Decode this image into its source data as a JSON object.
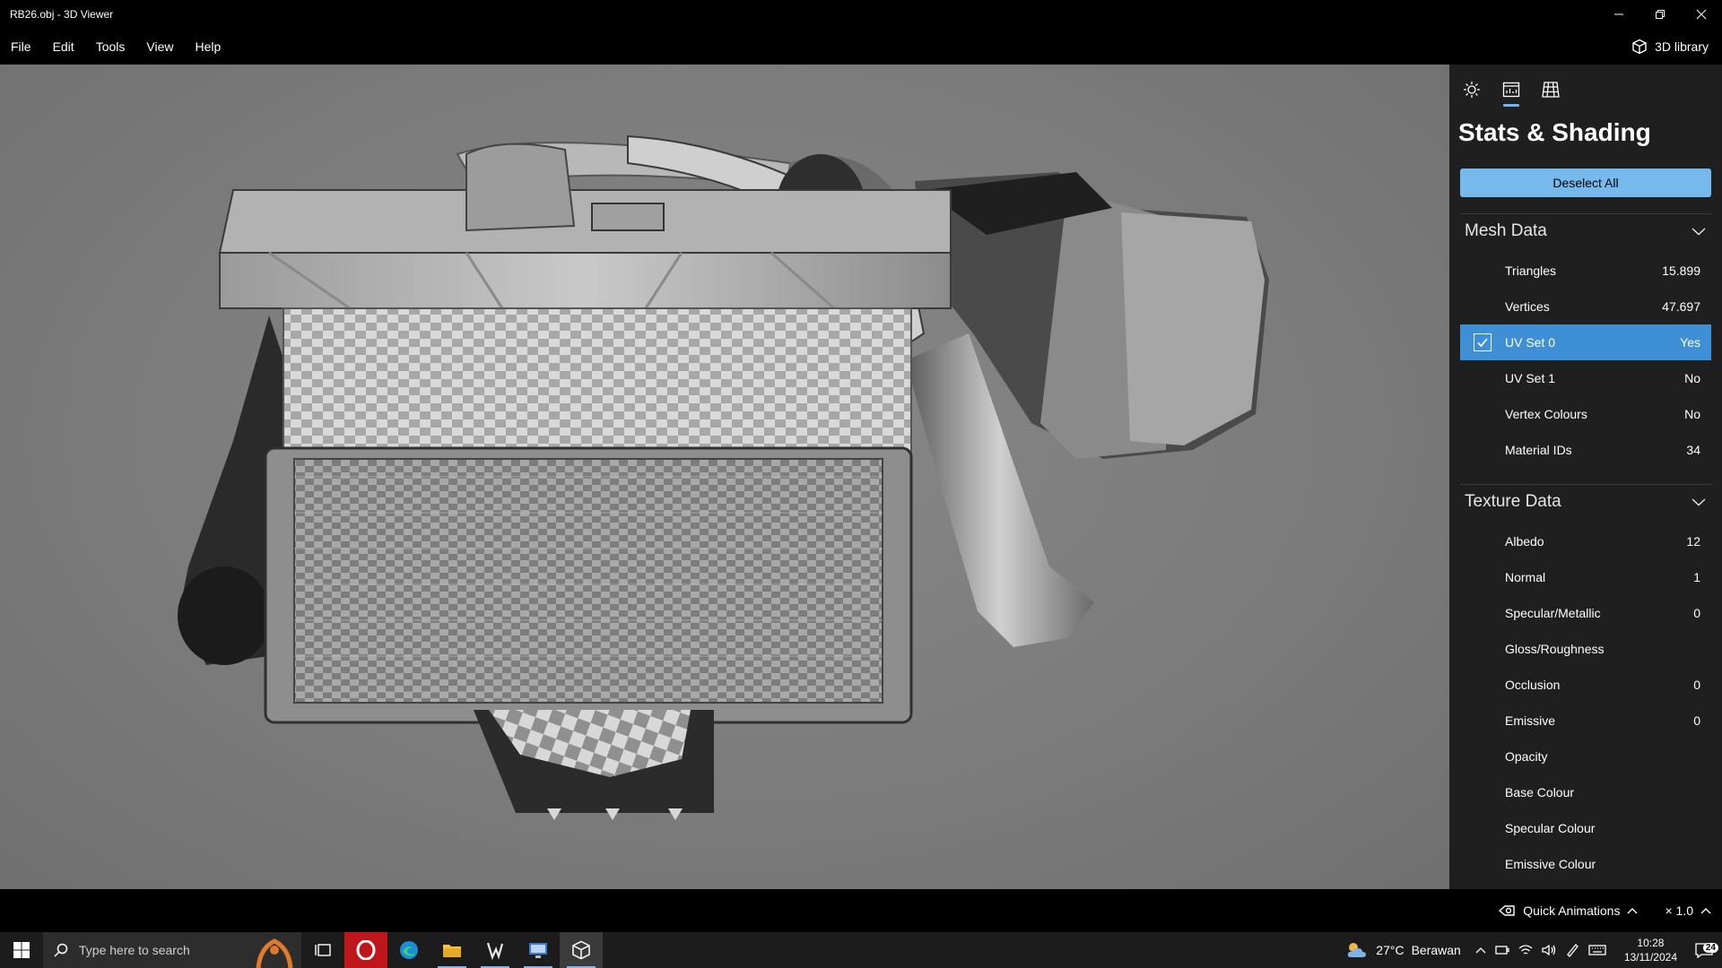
{
  "window": {
    "title": "RB26.obj - 3D Viewer"
  },
  "menubar": {
    "items": [
      "File",
      "Edit",
      "Tools",
      "View",
      "Help"
    ],
    "library_label": "3D library"
  },
  "panel": {
    "tab_icons": [
      "lighting-icon",
      "stats-icon",
      "grid-icon"
    ],
    "active_tab": 1,
    "title": "Stats & Shading",
    "deselect_label": "Deselect All",
    "mesh_section": {
      "title": "Mesh Data",
      "rows": [
        {
          "label": "Triangles",
          "value": "15.899",
          "checked": false
        },
        {
          "label": "Vertices",
          "value": "47.697",
          "checked": false
        },
        {
          "label": "UV Set 0",
          "value": "Yes",
          "checked": true
        },
        {
          "label": "UV Set 1",
          "value": "No",
          "checked": false
        },
        {
          "label": "Vertex Colours",
          "value": "No",
          "checked": false
        },
        {
          "label": "Material IDs",
          "value": "34",
          "checked": false
        }
      ]
    },
    "texture_section": {
      "title": "Texture Data",
      "rows": [
        {
          "label": "Albedo",
          "value": "12"
        },
        {
          "label": "Normal",
          "value": "1"
        },
        {
          "label": "Specular/Metallic",
          "value": "0"
        },
        {
          "label": "Gloss/Roughness",
          "value": ""
        },
        {
          "label": "Occlusion",
          "value": "0"
        },
        {
          "label": "Emissive",
          "value": "0"
        },
        {
          "label": "Opacity",
          "value": ""
        },
        {
          "label": "Base Colour",
          "value": ""
        },
        {
          "label": "Specular Colour",
          "value": ""
        },
        {
          "label": "Emissive Colour",
          "value": ""
        }
      ]
    }
  },
  "bottombar": {
    "quick_animations": "Quick Animations",
    "zoom": "× 1.0"
  },
  "taskbar": {
    "search_placeholder": "Type here to search",
    "weather_temp": "27°C",
    "weather_text": "Berawan",
    "time": "10:28",
    "date": "13/11/2024",
    "notification_count": "24"
  },
  "colors": {
    "accent": "#3f8fd6",
    "button": "#76b9ed",
    "panel_bg": "#1f1f1f",
    "viewport_bg": "#7f7f7f"
  }
}
